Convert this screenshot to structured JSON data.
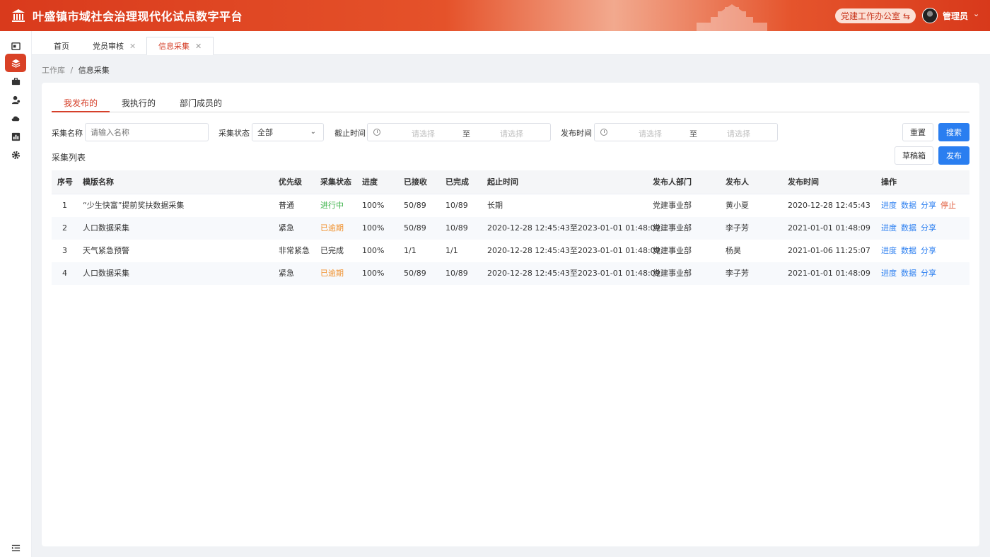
{
  "header": {
    "title": "叶盛镇市域社会治理现代化试点数字平台",
    "office": "党建工作办公室",
    "user": "管理员"
  },
  "sidebar": {
    "items": [
      "dashboard-icon",
      "layers-icon",
      "briefcase-icon",
      "users-icon",
      "cloud-icon",
      "chart-icon",
      "gear-icon"
    ],
    "active_index": 1
  },
  "tabs": [
    {
      "label": "首页"
    },
    {
      "label": "党员审核"
    },
    {
      "label": "信息采集"
    }
  ],
  "breadcrumb": {
    "root": "工作库",
    "sep": "/",
    "current": "信息采集"
  },
  "subtabs": [
    "我发布的",
    "我执行的",
    "部门成员的"
  ],
  "filters": {
    "name_label": "采集名称",
    "name_placeholder": "请输入名称",
    "status_label": "采集状态",
    "status_value": "全部",
    "deadline_label": "截止时间",
    "publish_label": "发布时间",
    "range_placeholder": "请选择",
    "range_sep": "至"
  },
  "buttons": {
    "reset": "重置",
    "search": "搜索",
    "draft": "草稿箱",
    "publish": "发布"
  },
  "list_title": "采集列表",
  "table": {
    "headers": [
      "序号",
      "模版名称",
      "优先级",
      "采集状态",
      "进度",
      "已接收",
      "已完成",
      "起止时间",
      "发布人部门",
      "发布人",
      "发布时间",
      "操作"
    ],
    "rows": [
      {
        "idx": "1",
        "name": "“少生快富”提前奖扶数据采集",
        "priority": "普通",
        "status": "进行中",
        "progress": "100%",
        "received": "50/89",
        "done": "10/89",
        "period": "长期",
        "dept": "党建事业部",
        "publisher": "黄小夏",
        "time": "2020-12-28 12:45:43",
        "ops": [
          "进度",
          "数据",
          "分享",
          "停止"
        ]
      },
      {
        "idx": "2",
        "name": "人口数据采集",
        "priority": "紧急",
        "status": "已逾期",
        "progress": "100%",
        "received": "50/89",
        "done": "10/89",
        "period": "2020-12-28 12:45:43至2023-01-01 01:48:09",
        "dept": "党建事业部",
        "publisher": "李子芳",
        "time": "2021-01-01 01:48:09",
        "ops": [
          "进度",
          "数据",
          "分享"
        ]
      },
      {
        "idx": "3",
        "name": "天气紧急预警",
        "priority": "非常紧急",
        "status": "已完成",
        "progress": "100%",
        "received": "1/1",
        "done": "1/1",
        "period": "2020-12-28 12:45:43至2023-01-01 01:48:09",
        "dept": "党建事业部",
        "publisher": "杨昊",
        "time": "2021-01-06 11:25:07",
        "ops": [
          "进度",
          "数据",
          "分享"
        ]
      },
      {
        "idx": "4",
        "name": "人口数据采集",
        "priority": "紧急",
        "status": "已逾期",
        "progress": "100%",
        "received": "50/89",
        "done": "10/89",
        "period": "2020-12-28 12:45:43至2023-01-01 01:48:09",
        "dept": "党建事业部",
        "publisher": "李子芳",
        "time": "2021-01-01 01:48:09",
        "ops": [
          "进度",
          "数据",
          "分享"
        ]
      }
    ]
  },
  "colors": {
    "brand": "#d94126",
    "primary": "#2a7ef0",
    "ongoing": "#3cb34a",
    "overdue": "#f0902b"
  }
}
